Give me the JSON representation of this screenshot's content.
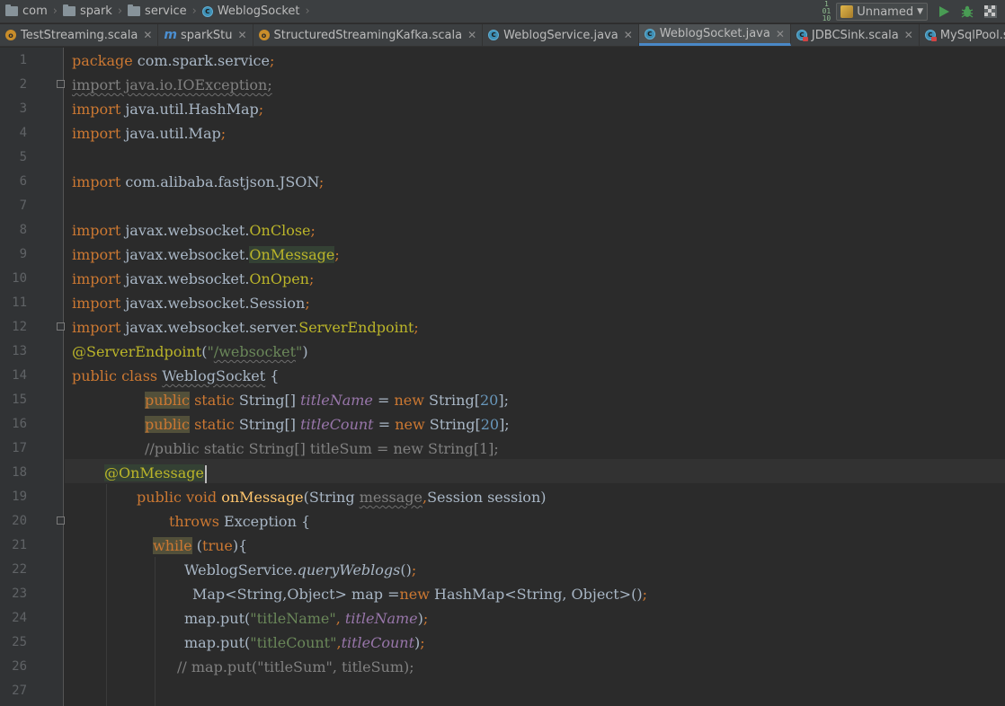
{
  "breadcrumbs": [
    "com",
    "spark",
    "service",
    "WeblogSocket"
  ],
  "run_config": {
    "label": "Unnamed"
  },
  "tabs": [
    {
      "label": "TestStreaming.scala",
      "icon": "object-icon",
      "active": false
    },
    {
      "label": "sparkStu",
      "icon": "maven-icon",
      "active": false
    },
    {
      "label": "StructuredStreamingKafka.scala",
      "icon": "object-icon",
      "active": false
    },
    {
      "label": "WeblogService.java",
      "icon": "class-icon",
      "active": false
    },
    {
      "label": "WeblogSocket.java",
      "icon": "class-icon",
      "active": true
    },
    {
      "label": "JDBCSink.scala",
      "icon": "class-icon",
      "active": false
    },
    {
      "label": "MySqlPool.scala",
      "icon": "class-icon",
      "active": false
    }
  ],
  "line_numbers": [
    "1",
    "2",
    "3",
    "4",
    "5",
    "6",
    "7",
    "8",
    "9",
    "10",
    "11",
    "12",
    "13",
    "14",
    "15",
    "16",
    "17",
    "18",
    "19",
    "20",
    "21",
    "22",
    "23",
    "24",
    "25",
    "26",
    "27"
  ],
  "code": {
    "l1": {
      "kw": "package",
      "rest": " com.spark.service",
      "semi": ";"
    },
    "l2": {
      "text": "import java.io.IOException;"
    },
    "l3": {
      "kw": "import",
      "rest": " java.util.HashMap",
      "semi": ";"
    },
    "l4": {
      "kw": "import",
      "rest": " java.util.Map",
      "semi": ";"
    },
    "l6": {
      "kw": "import",
      "rest": " com.alibaba.fastjson.JSON",
      "semi": ";"
    },
    "l8": {
      "kw": "import",
      "pkg": " javax.websocket.",
      "ann": "OnClose",
      "semi": ";"
    },
    "l9": {
      "kw": "import",
      "pkg": " javax.websocket.",
      "ann": "OnMessage",
      "semi": ";"
    },
    "l10": {
      "kw": "import",
      "pkg": " javax.websocket.",
      "ann": "OnOpen",
      "semi": ";"
    },
    "l11": {
      "kw": "import",
      "pkg": " javax.websocket.",
      "cls": "Session",
      "semi": ";"
    },
    "l12": {
      "kw": "import",
      "pkg": " javax.websocket.server.",
      "ann": "ServerEndpoint",
      "semi": ";"
    },
    "l13": {
      "ann": "@ServerEndpoint",
      "p1": "(",
      "q1": "\"",
      "str": "/websocket",
      "q2": "\"",
      "p2": ")"
    },
    "l14": {
      "kw1": "public",
      "kw2": " class ",
      "cls": "WeblogSocket",
      "rest": " {"
    },
    "l15": {
      "kw1": "public",
      "kw2": " static ",
      "type": "String[] ",
      "fld": "titleName",
      "eq": " = ",
      "kw3": "new ",
      "cls": "String[",
      "num": "20",
      "end": "];"
    },
    "l16": {
      "kw1": "public",
      "kw2": " static ",
      "type": "String[] ",
      "fld": "titleCount",
      "eq": " = ",
      "kw3": "new ",
      "cls": "String[",
      "num": "20",
      "end": "];"
    },
    "l17": {
      "text": "//public static String[] titleSum = new String[1];"
    },
    "l18": {
      "ann": "@OnMessage"
    },
    "l19": {
      "kw": "public void ",
      "meth": "onMessage",
      "p1": "(String ",
      "param": "message",
      "comma": ",",
      "rest": "Session session)"
    },
    "l20": {
      "kw": "throws",
      "rest": " Exception {"
    },
    "l21": {
      "kw": "while",
      "p1": " (",
      "kw2": "true",
      "p2": "){"
    },
    "l22": {
      "cls": "WeblogService.",
      "smeth": "queryWeblogs",
      "end": "()",
      "semi": ";"
    },
    "l23": {
      "type": "Map<String,Object> map =",
      "kw": "new",
      "rest": " HashMap<String, Object>()",
      "semi": ";"
    },
    "l24": {
      "call": "map.put(",
      "str": "\"titleName\"",
      "comma": ", ",
      "fld": "titleName",
      "end": ")",
      "semi": ";"
    },
    "l25": {
      "call": "map.put(",
      "str": "\"titleCount\"",
      "comma": ",",
      "fld": "titleCount",
      "end": ")",
      "semi": ";"
    },
    "l26": {
      "text": "// map.put(\"titleSum\", titleSum);"
    }
  },
  "colors": {
    "background": "#2b2b2b",
    "keyword": "#cc7832",
    "annotation": "#bbb529",
    "string": "#6a8759",
    "number": "#6897bb",
    "field": "#9876aa",
    "method": "#ffc66d",
    "comment": "#808080",
    "active_tab_underline": "#4a88c7"
  }
}
